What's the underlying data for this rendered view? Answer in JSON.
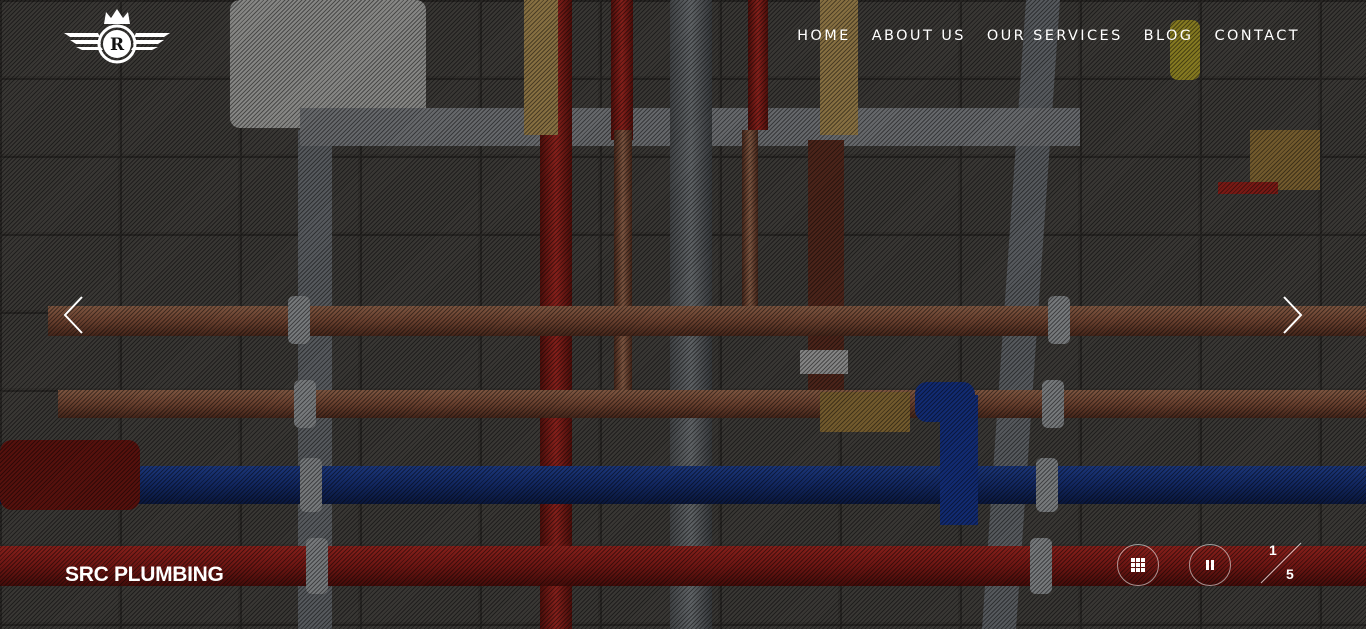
{
  "brand": {
    "logo_letter": "R",
    "logo_alt": "SRC Plumbing crest logo"
  },
  "nav": {
    "items": [
      {
        "label": "HOME"
      },
      {
        "label": "ABOUT US"
      },
      {
        "label": "OUR SERVICES"
      },
      {
        "label": "BLOG"
      },
      {
        "label": "CONTACT"
      }
    ]
  },
  "slider": {
    "caption": "SRC PLUMBING",
    "current": "1",
    "total": "5",
    "prev_icon": "chevron-left-icon",
    "next_icon": "chevron-right-icon",
    "grid_icon": "grid-icon",
    "pause_icon": "pause-icon"
  },
  "colors": {
    "text": "#ffffff",
    "pipe_red": "#b0241f",
    "pipe_blue": "#1d3f9a",
    "pipe_copper": "#a8664a",
    "wall": "#4a4744"
  }
}
